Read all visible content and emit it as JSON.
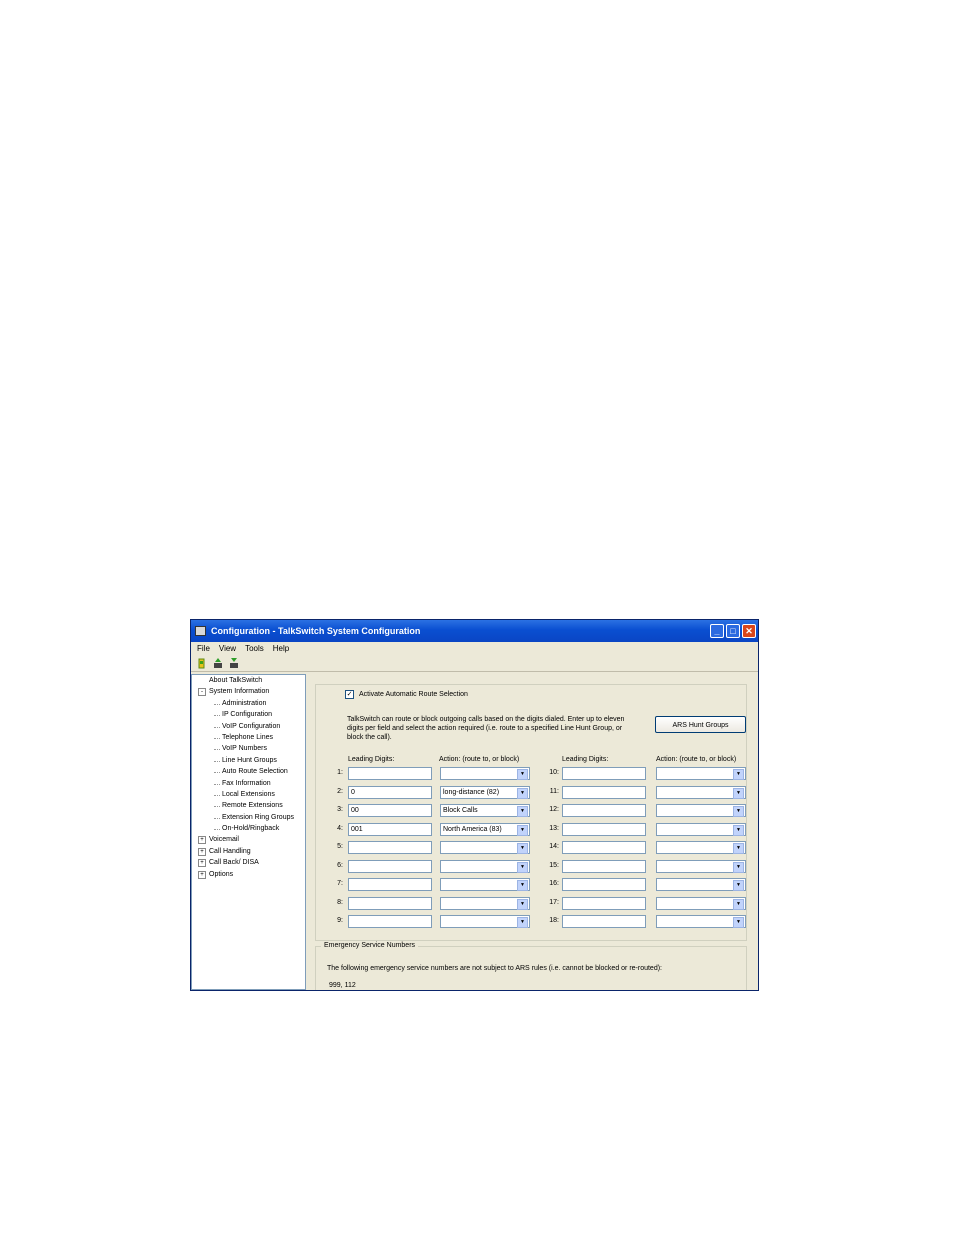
{
  "window": {
    "title": "Configuration - TalkSwitch System Configuration",
    "min": "_",
    "max": "□",
    "close": "✕"
  },
  "menu": [
    "File",
    "View",
    "Tools",
    "Help"
  ],
  "toolbar_icons": [
    "connect-icon",
    "upload-icon",
    "download-icon"
  ],
  "tree": [
    {
      "label": "About TalkSwitch",
      "level": 0,
      "expander": ""
    },
    {
      "label": "System Information",
      "level": 0,
      "expander": "-"
    },
    {
      "label": "Administration",
      "level": 1
    },
    {
      "label": "IP Configuration",
      "level": 1
    },
    {
      "label": "VoIP Configuration",
      "level": 1
    },
    {
      "label": "Telephone Lines",
      "level": 1
    },
    {
      "label": "VoIP Numbers",
      "level": 1
    },
    {
      "label": "Line Hunt Groups",
      "level": 1
    },
    {
      "label": "Auto Route Selection",
      "level": 1
    },
    {
      "label": "Fax Information",
      "level": 1
    },
    {
      "label": "Local Extensions",
      "level": 1
    },
    {
      "label": "Remote Extensions",
      "level": 1
    },
    {
      "label": "Extension Ring Groups",
      "level": 1
    },
    {
      "label": "On-Hold/Ringback",
      "level": 1
    },
    {
      "label": "Voicemail",
      "level": 0,
      "expander": "+"
    },
    {
      "label": "Call Handling",
      "level": 0,
      "expander": "+"
    },
    {
      "label": "Call Back/ DISA",
      "level": 0,
      "expander": "+"
    },
    {
      "label": "Options",
      "level": 0,
      "expander": "+"
    }
  ],
  "ars": {
    "activate_label": "Activate Automatic Route Selection",
    "activate_checked": "✓",
    "description": "TalkSwitch can route or block outgoing calls based on the digits dialed. Enter up to eleven digits per field and select the action required (i.e. route to a specified Line Hunt Group, or block the call).",
    "hunt_groups_button": "ARS Hunt Groups",
    "col_leading": "Leading Digits:",
    "col_action": "Action: (route to, or block)",
    "rows_left": [
      {
        "num": "1:",
        "digits": "",
        "action": ""
      },
      {
        "num": "2:",
        "digits": "0",
        "action": "long-distance (82)"
      },
      {
        "num": "3:",
        "digits": "00",
        "action": "Block Calls"
      },
      {
        "num": "4:",
        "digits": "001",
        "action": "North America (83)"
      },
      {
        "num": "5:",
        "digits": "",
        "action": ""
      },
      {
        "num": "6:",
        "digits": "",
        "action": ""
      },
      {
        "num": "7:",
        "digits": "",
        "action": ""
      },
      {
        "num": "8:",
        "digits": "",
        "action": ""
      },
      {
        "num": "9:",
        "digits": "",
        "action": ""
      }
    ],
    "rows_right": [
      {
        "num": "10:",
        "digits": "",
        "action": ""
      },
      {
        "num": "11:",
        "digits": "",
        "action": ""
      },
      {
        "num": "12:",
        "digits": "",
        "action": ""
      },
      {
        "num": "13:",
        "digits": "",
        "action": ""
      },
      {
        "num": "14:",
        "digits": "",
        "action": ""
      },
      {
        "num": "15:",
        "digits": "",
        "action": ""
      },
      {
        "num": "16:",
        "digits": "",
        "action": ""
      },
      {
        "num": "17:",
        "digits": "",
        "action": ""
      },
      {
        "num": "18:",
        "digits": "",
        "action": ""
      }
    ]
  },
  "emergency": {
    "title": "Emergency Service Numbers",
    "text": "The following emergency service numbers are not subject to ARS rules (i.e. cannot be blocked or re-routed):",
    "numbers": "999, 112"
  }
}
